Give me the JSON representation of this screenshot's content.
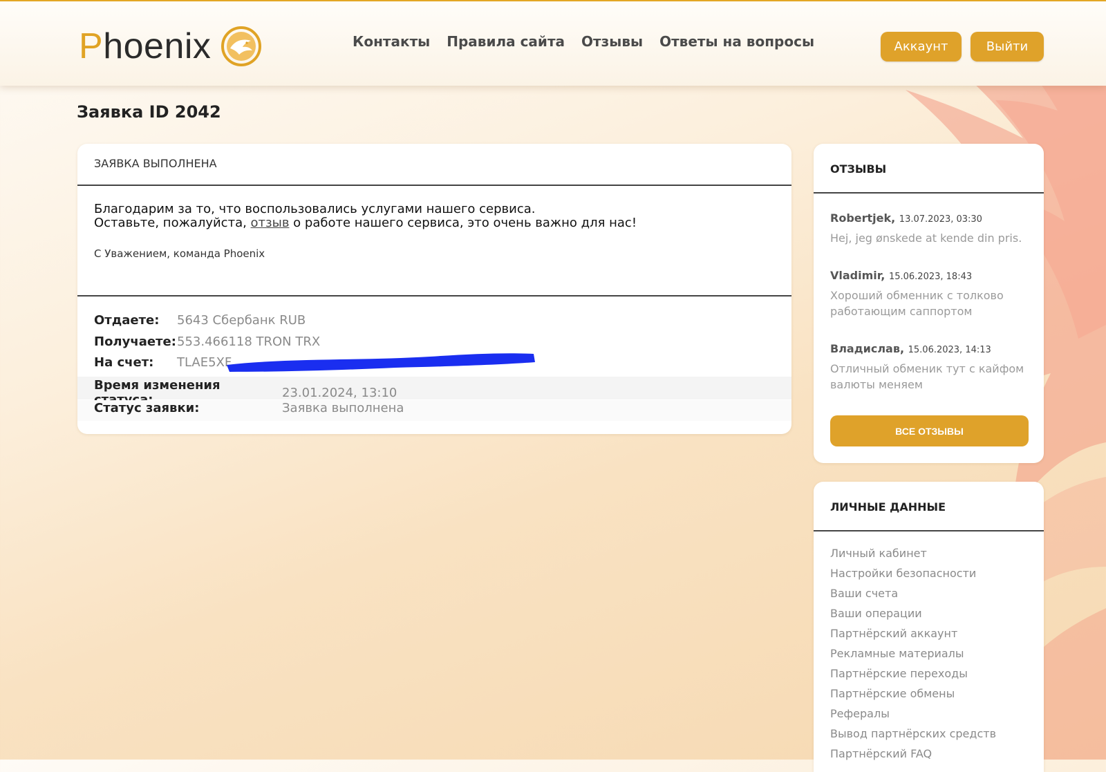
{
  "header": {
    "logo": {
      "first_letter": "P",
      "rest": "hoenix"
    },
    "nav": [
      "Контакты",
      "Правила сайта",
      "Отзывы",
      "Ответы на вопросы"
    ],
    "account_button": "Аккаунт",
    "logout_button": "Выйти"
  },
  "page_title": "Заявка ID 2042",
  "order": {
    "status_heading": "ЗАЯВКА ВЫПОЛНЕНА",
    "thanks_line": "Благодарим за то, что воспользовались услугами нашего сервиса.",
    "leave_prefix": "Оставьте, пожалуйста, ",
    "leave_link": "отзыв",
    "leave_suffix": " о работе нашего сервиса, это очень важно для нас!",
    "signature": "С Уважением, команда Phoenix",
    "give_label": "Отдаете:",
    "give_value": "5643 Сбербанк RUB",
    "receive_label": "Получаете:",
    "receive_value": "553.466118 TRON TRX",
    "account_label": "На счет:",
    "account_value": "TLAE5XF",
    "status_time_label": "Время изменения статуса:",
    "status_time_value": "23.01.2024, 13:10",
    "status_label": "Статус заявки:",
    "status_value": "Заявка выполнена"
  },
  "reviews": {
    "heading": "ОТЗЫВЫ",
    "items": [
      {
        "author": "Robertjek,",
        "date": "13.07.2023, 03:30",
        "text": "Hej, jeg ønskede at kende din pris."
      },
      {
        "author": "Vladimir,",
        "date": "15.06.2023, 18:43",
        "text": "Хороший обменник с толково работающим саппортом"
      },
      {
        "author": "Владислав,",
        "date": "15.06.2023, 14:13",
        "text": "Отличный обменик тут с кайфом валюты меняем"
      }
    ],
    "all_button": "ВСЕ ОТЗЫВЫ"
  },
  "personal": {
    "heading": "ЛИЧНЫЕ ДАННЫЕ",
    "links": [
      "Личный кабинет",
      "Настройки безопасности",
      "Ваши счета",
      "Ваши операции",
      "Партнёрский аккаунт",
      "Рекламные материалы",
      "Партнёрские переходы",
      "Партнёрские обмены",
      "Рефералы",
      "Вывод партнёрских средств",
      "Партнёрский FAQ"
    ]
  },
  "colors": {
    "accent": "#dfa22a",
    "redaction": "#1a2ef0",
    "feather": "#f08a78"
  }
}
